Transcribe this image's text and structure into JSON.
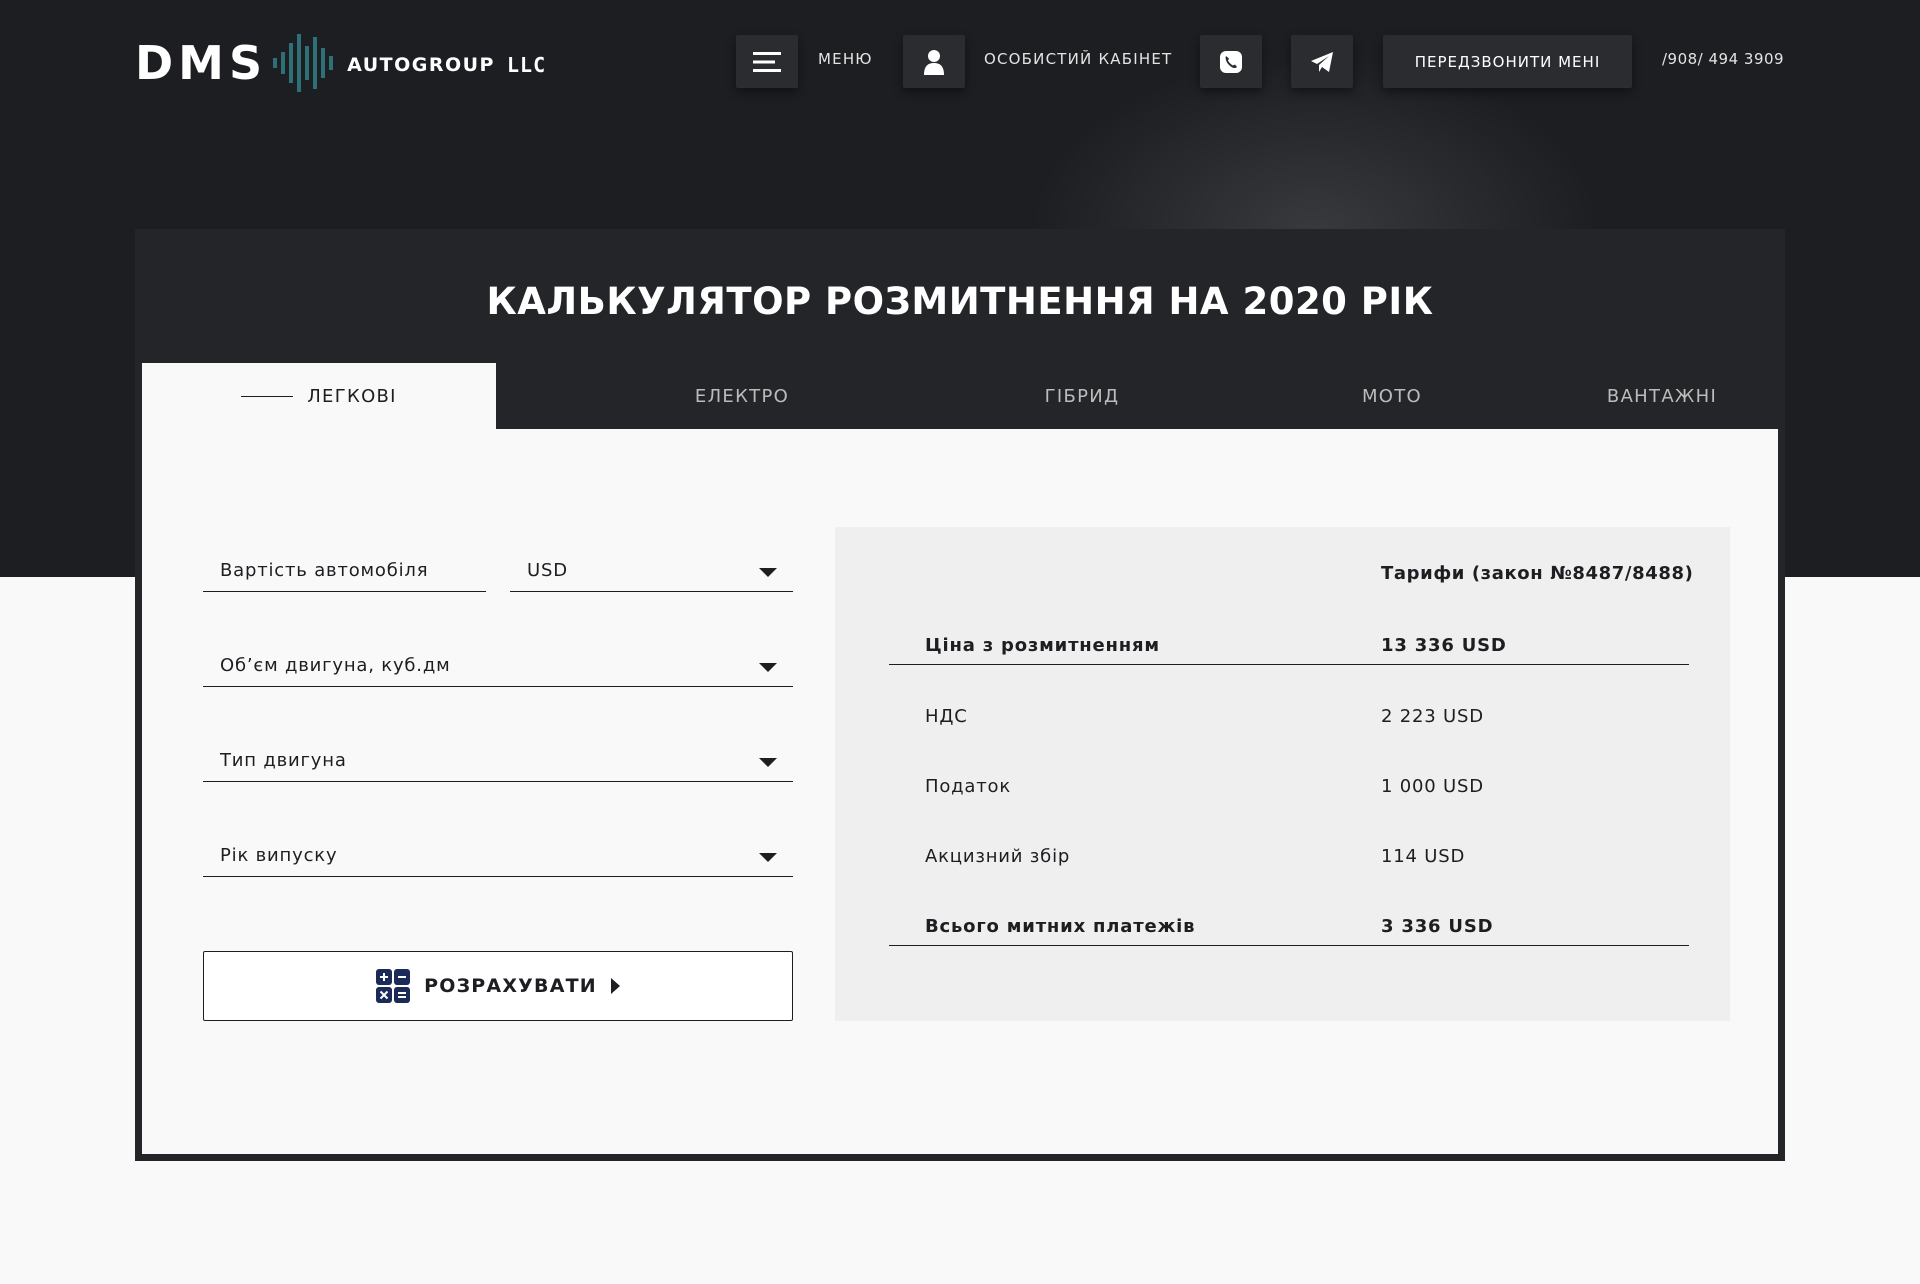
{
  "header": {
    "logo": {
      "dms": "DMS",
      "autogroup": "AUTOGROUP",
      "llc": "LLC"
    },
    "menu_label": "МЕНЮ",
    "account_label": "ОСОБИСТИЙ КАБІНЕТ",
    "callback_label": "ПЕРЕДЗВОНИТИ МЕНІ",
    "phone": "/908/ 494 3909",
    "icons": [
      "menu-icon",
      "user-icon",
      "viber-icon",
      "telegram-icon"
    ]
  },
  "calculator": {
    "title": "КАЛЬКУЛЯТОР РОЗМИТНЕННЯ НА 2020 РІК",
    "tabs": [
      {
        "label": "ЛЕГКОВІ",
        "active": true
      },
      {
        "label": "ЕЛЕКТРО",
        "active": false
      },
      {
        "label": "ГІБРИД",
        "active": false
      },
      {
        "label": "МОТО",
        "active": false
      },
      {
        "label": "ВАНТАЖНІ",
        "active": false
      }
    ],
    "form": {
      "car_value_placeholder": "Вартість автомобіля",
      "currency": "USD",
      "engine_volume": "Об’єм двигуна, куб.дм",
      "engine_type": "Тип двигуна",
      "year": "Рік випуску",
      "calculate_label": "РОЗРАХУВАТИ",
      "calculate_icon": "calculator-icon"
    },
    "results": {
      "header": "Тарифи (закон №8487/8488)",
      "rows": [
        {
          "label": "Ціна з розмитненням",
          "value": "13 336 USD"
        },
        {
          "label": "НДС",
          "value": "2 223 USD"
        },
        {
          "label": "Податок",
          "value": "1 000 USD"
        },
        {
          "label": "Акцизний збір",
          "value": "114 USD"
        },
        {
          "label": "Всього митних платежів",
          "value": "3 336 USD"
        }
      ]
    }
  },
  "colors": {
    "dark_bg": "#1d1e21",
    "card_dark": "#242528",
    "button_dark": "#2b2c30",
    "logo_accent": "#2f6f78",
    "calc_icon": "#1b2a57",
    "light_bg": "#f9f9f9",
    "results_bg": "#efefef"
  }
}
